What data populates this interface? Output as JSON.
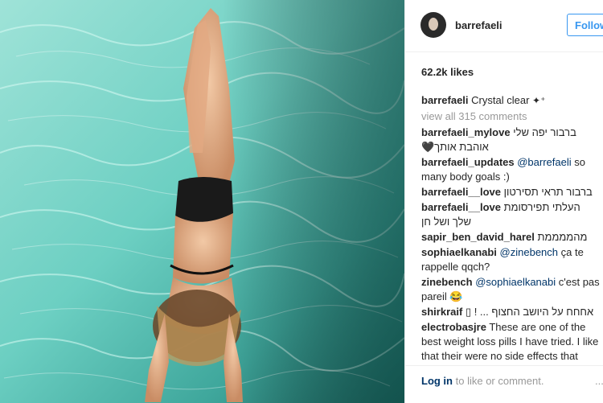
{
  "post": {
    "username": "barrefaeli",
    "follow_label": "Follow",
    "likes": "62.2k likes",
    "caption_user": "barrefaeli",
    "caption_text": "Crystal clear",
    "caption_emoji": "✦⁺",
    "view_all": "view all 315 comments"
  },
  "comments": [
    {
      "user": "barrefaeli_mylove",
      "text": "ברבור יפה שלי אוהבת אותך🖤"
    },
    {
      "user": "barrefaeli_updates",
      "mention": "@barrefaeli",
      "text": "so many body goals :)"
    },
    {
      "user": "barrefaeli__love",
      "text": "ברבור תראי תסירטון"
    },
    {
      "user": "barrefaeli__love",
      "text": "העלתי תפירסומת שלך ושל חן"
    },
    {
      "user": "sapir_ben_david_harel",
      "text": "מהממממת"
    },
    {
      "user": "sophiaelkanabi",
      "mention": "@zinebench",
      "text": "ça te rappelle qqch?"
    },
    {
      "user": "zinebench",
      "mention": "@sophiaelkanabi",
      "text": "c'est pas pareil 😂"
    },
    {
      "user": "shirkraif",
      "text": "אחחח על היושב החצוף ... ! ▯"
    },
    {
      "user": "electrobasjre",
      "text": "These are one of the best weight loss pills I have tried. I like that their were no side effects that some diet"
    }
  ],
  "footer": {
    "login_link": "Log in",
    "login_text": "to like or comment.",
    "more": "..."
  },
  "colors": {
    "accent": "#3897f0",
    "link": "#003569",
    "muted": "#999999",
    "water": "#7fd3c7"
  }
}
